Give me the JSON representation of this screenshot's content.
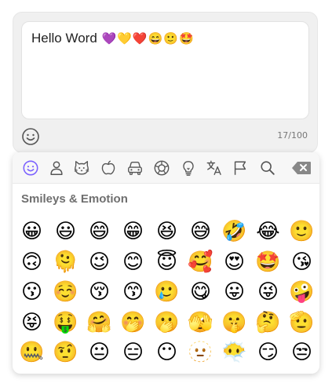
{
  "composer": {
    "text": "Hello Word",
    "text_emojis": [
      "💜",
      "💛",
      "❤️",
      "😄",
      "🙂",
      "🤩"
    ],
    "counter": "17/100",
    "smile_icon": "smiley-outline-icon"
  },
  "picker": {
    "tabs": [
      {
        "name": "smileys",
        "icon": "smiley-icon",
        "active": true
      },
      {
        "name": "people",
        "icon": "person-icon"
      },
      {
        "name": "animals",
        "icon": "cat-icon"
      },
      {
        "name": "food",
        "icon": "apple-icon"
      },
      {
        "name": "travel",
        "icon": "car-icon"
      },
      {
        "name": "activities",
        "icon": "soccer-ball-icon"
      },
      {
        "name": "objects",
        "icon": "lightbulb-icon"
      },
      {
        "name": "symbols",
        "icon": "translate-icon"
      },
      {
        "name": "flags",
        "icon": "flag-icon"
      },
      {
        "name": "search",
        "icon": "search-icon"
      }
    ],
    "backspace_icon": "backspace-icon",
    "category_title": "Smileys & Emotion",
    "emojis": [
      "😀",
      "😃",
      "😄",
      "😁",
      "😆",
      "😅",
      "🤣",
      "😂",
      "🙂",
      "🙃",
      "🫠",
      "😉",
      "😊",
      "😇",
      "🥰",
      "😍",
      "🤩",
      "😘",
      "😗",
      "☺️",
      "😚",
      "😙",
      "🥲",
      "😋",
      "😛",
      "😜",
      "🤪",
      "😝",
      "🤑",
      "🤗",
      "🤭",
      "🫢",
      "🫣",
      "🤫",
      "🤔",
      "🫡",
      "🤐",
      "🤨",
      "😐",
      "😑",
      "😶",
      "🫥",
      "😶‍🌫️",
      "😏",
      "😒"
    ],
    "colors": {
      "accent": "#7b61ff",
      "icon_gray": "#555555",
      "backspace_gray": "#888888"
    }
  }
}
